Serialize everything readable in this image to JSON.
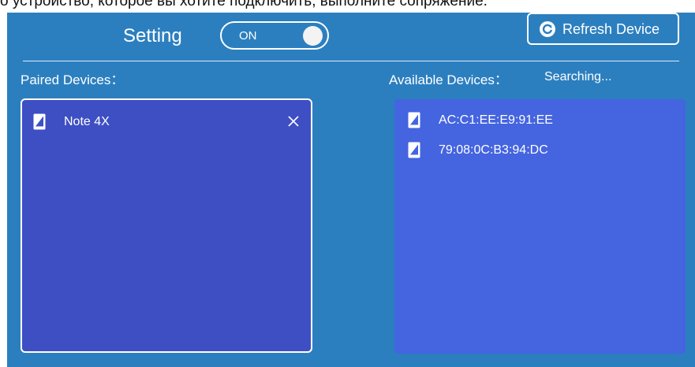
{
  "banner": {
    "text": "о устройство, которое вы хотите подключить, выполните сопряжение."
  },
  "header": {
    "setting_label": "Setting",
    "toggle_label": "ON",
    "toggle_on": true,
    "refresh_label": "Refresh Device"
  },
  "paired": {
    "label": "Paired Devices：",
    "devices": [
      {
        "name": "Note 4X",
        "icon": "phone-icon"
      }
    ]
  },
  "available": {
    "label": "Available Devices：",
    "status": "Searching...",
    "devices": [
      {
        "name": "AC:C1:EE:E9:91:EE",
        "icon": "phone-icon"
      },
      {
        "name": "79:08:0C:B3:94:DC",
        "icon": "phone-icon"
      }
    ]
  },
  "colors": {
    "background": "#2c7fbf",
    "paired_panel": "#3e4fc4",
    "available_panel": "#4464e0",
    "text": "#ffffff"
  }
}
